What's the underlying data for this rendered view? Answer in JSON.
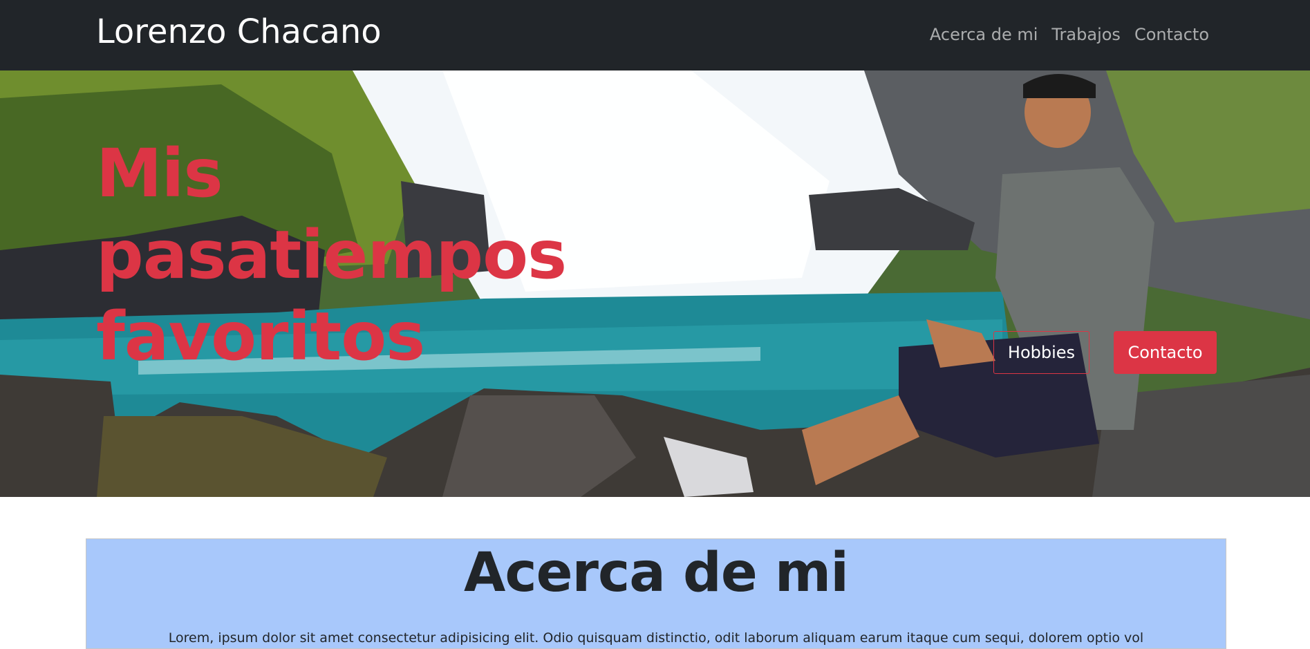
{
  "navbar": {
    "brand": "Lorenzo Chacano",
    "links": [
      "Acerca de mi",
      "Trabajos",
      "Contacto"
    ],
    "background": "#212529"
  },
  "hero": {
    "title": "Mis pasatiempos favoritos",
    "buttons": {
      "hobbies": "Hobbies",
      "contact": "Contacto"
    },
    "accent": "#dc3545"
  },
  "about": {
    "heading": "Acerca de mi",
    "text": "Lorem, ipsum dolor sit amet consectetur adipisicing elit. Odio quisquam distinctio, odit laborum aliquam earum itaque cum sequi, dolorem optio vol",
    "background": "#a8c8fb"
  }
}
